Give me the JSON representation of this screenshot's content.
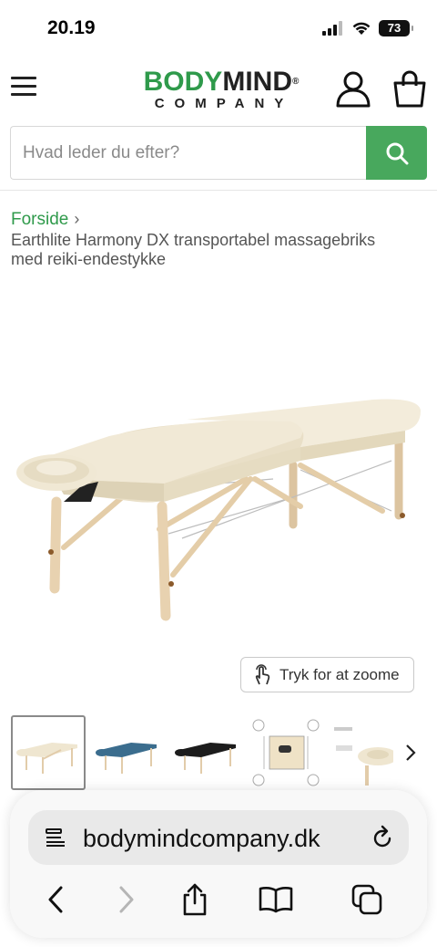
{
  "status_bar": {
    "time": "20.19",
    "battery": "73"
  },
  "header": {
    "logo_part1": "BODY",
    "logo_part2": "MIND",
    "logo_reg": "®",
    "logo_bottom": "COMPANY"
  },
  "search": {
    "placeholder": "Hvad leder du efter?"
  },
  "breadcrumb": {
    "home": "Forside",
    "separator": "›",
    "current": "Earthlite Harmony DX transportabel massagebriks med reiki-endestykke"
  },
  "zoom_label": "Tryk for at zoome",
  "thumbnails": [
    "cream table",
    "blue table",
    "black table",
    "dimensions diagram",
    "detail view"
  ],
  "bg_title": "endestykke",
  "browser": {
    "url": "bodymindcompany.dk"
  },
  "colors": {
    "brand_green": "#2f9a4b",
    "search_button": "#48a85d",
    "table_cream": "#efe6d0",
    "table_wood": "#e8d2b0"
  }
}
